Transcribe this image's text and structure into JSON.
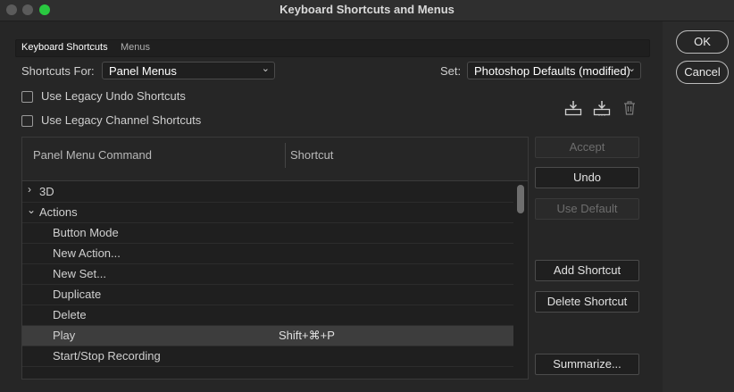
{
  "window": {
    "title": "Keyboard Shortcuts and Menus"
  },
  "tabs": {
    "active": "Keyboard Shortcuts",
    "inactive": "Menus"
  },
  "shortcuts_for": {
    "label": "Shortcuts For:",
    "value": "Panel Menus"
  },
  "set": {
    "label": "Set:",
    "value": "Photoshop Defaults (modified)"
  },
  "options": {
    "legacy_undo": "Use Legacy Undo Shortcuts",
    "legacy_channel": "Use Legacy Channel Shortcuts"
  },
  "table": {
    "headers": {
      "command": "Panel Menu Command",
      "shortcut": "Shortcut"
    },
    "rows": [
      {
        "label": "3D",
        "type": "group",
        "expanded": false,
        "shortcut": ""
      },
      {
        "label": "Actions",
        "type": "group",
        "expanded": true,
        "shortcut": ""
      },
      {
        "label": "Button Mode",
        "type": "item",
        "shortcut": ""
      },
      {
        "label": "New Action...",
        "type": "item",
        "shortcut": ""
      },
      {
        "label": "New Set...",
        "type": "item",
        "shortcut": ""
      },
      {
        "label": "Duplicate",
        "type": "item",
        "shortcut": ""
      },
      {
        "label": "Delete",
        "type": "item",
        "shortcut": ""
      },
      {
        "label": "Play",
        "type": "item",
        "selected": true,
        "shortcut": "Shift+⌘+P"
      },
      {
        "label": "Start/Stop Recording",
        "type": "item",
        "shortcut": ""
      }
    ]
  },
  "side_buttons": {
    "accept": "Accept",
    "undo": "Undo",
    "use_default": "Use Default",
    "add_shortcut": "Add Shortcut",
    "delete_shortcut": "Delete Shortcut",
    "summarize": "Summarize..."
  },
  "dialog_buttons": {
    "ok": "OK",
    "cancel": "Cancel"
  },
  "icons": {
    "save_set": "save-set-icon",
    "save_set_as": "save-set-as-icon",
    "delete_set": "trash-icon",
    "expand": "chevron-right-icon",
    "collapse": "chevron-down-icon"
  },
  "colors": {
    "accent": "#29c840",
    "background": "#262626",
    "selected_row": "#3d3d3d"
  }
}
